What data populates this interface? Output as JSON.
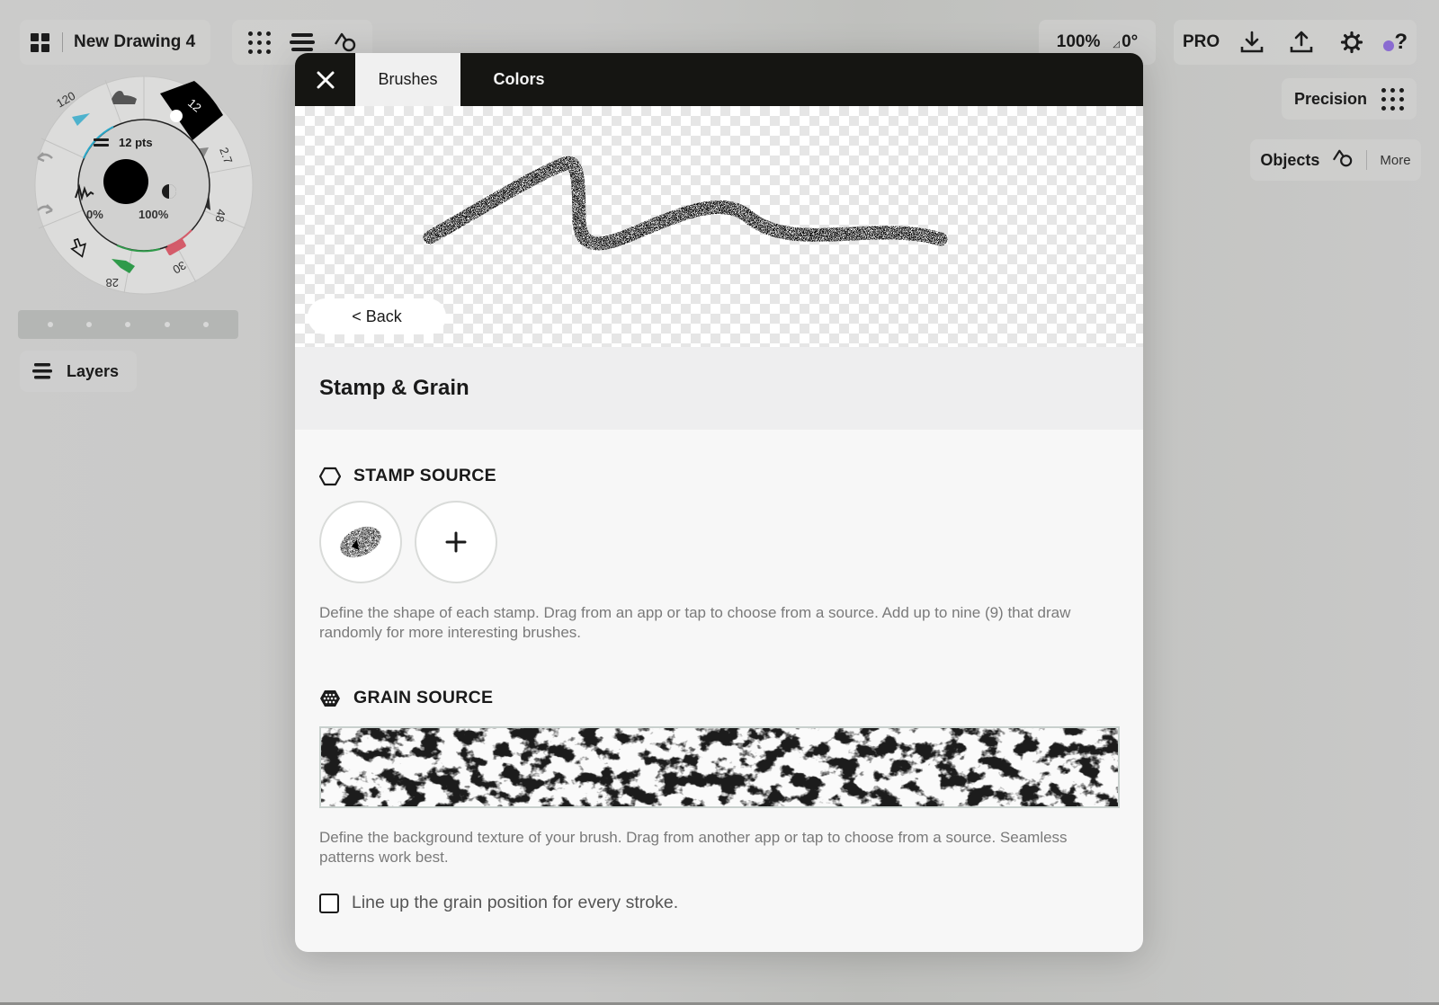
{
  "app": {
    "document_title": "New Drawing 4",
    "zoom_level": "100%",
    "rotation": "0°",
    "pro_label": "PRO",
    "help_label": "?",
    "precision_label": "Precision",
    "objects_label": "Objects",
    "more_label": "More",
    "layers_label": "Layers",
    "accent_color": "#8a6bd1"
  },
  "toolbar_icons": [
    {
      "name": "gallery-grid-icon"
    },
    {
      "name": "grid-dots-icon"
    },
    {
      "name": "layers-stack-icon"
    },
    {
      "name": "shapes-icon"
    },
    {
      "name": "download-icon"
    },
    {
      "name": "upload-icon"
    },
    {
      "name": "settings-gear-icon"
    }
  ],
  "brush_wheel": {
    "size_label": "12 pts",
    "smoothing_label": "0%",
    "opacity_label": "100%",
    "tools": [
      {
        "name": "wash",
        "value": "120",
        "color": "#2aa8c9"
      },
      {
        "name": "marker",
        "value": "",
        "color": "#555555"
      },
      {
        "name": "pen",
        "value": "12",
        "color": "#000000",
        "selected": true
      },
      {
        "name": "pencil",
        "value": "2.7",
        "color": "#444444"
      },
      {
        "name": "airbrush",
        "value": "48",
        "color": "#111111"
      },
      {
        "name": "eraser",
        "value": "30",
        "color": "#d45c6a"
      },
      {
        "name": "highlighter",
        "value": "28",
        "color": "#2f9a4a"
      },
      {
        "name": "selection",
        "value": "",
        "color": "#111111"
      }
    ]
  },
  "modal": {
    "close_label": "✕",
    "tabs": [
      {
        "label": "Brushes",
        "active": true
      },
      {
        "label": "Colors",
        "active": false
      }
    ],
    "back_label": "< Back",
    "section_title": "Stamp & Grain",
    "stamp_source": {
      "heading": "STAMP SOURCE",
      "add_label": "+",
      "description": "Define the shape of each stamp. Drag from an app or tap to choose from a source. Add up to nine (9) that draw randomly for more interesting brushes."
    },
    "grain_source": {
      "heading": "GRAIN SOURCE",
      "description": "Define the background texture of your brush. Drag from another app or tap to choose from a source. Seamless patterns work best.",
      "align_checkbox_label": "Line up the grain position for every stroke.",
      "align_checked": false
    }
  }
}
